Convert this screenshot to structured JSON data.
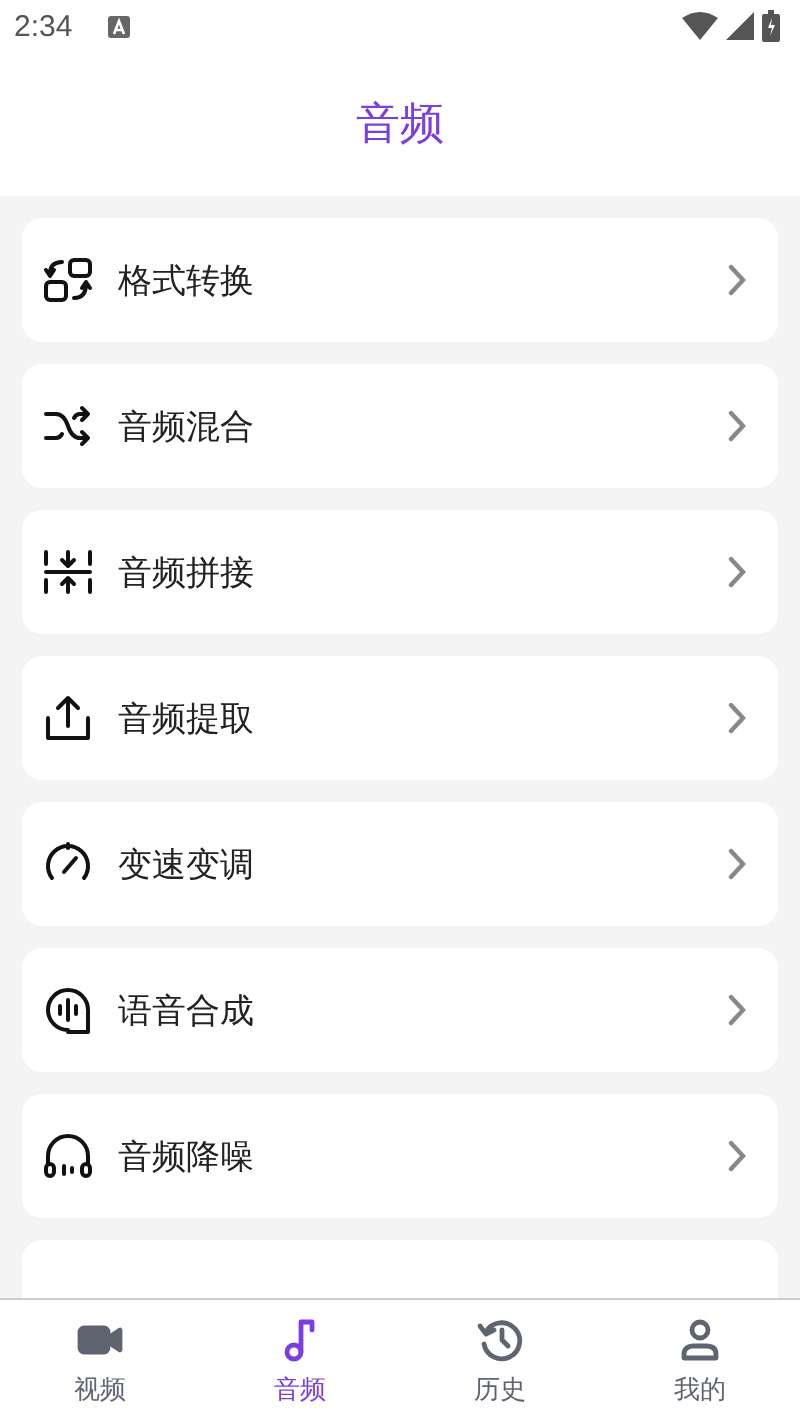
{
  "status_bar": {
    "time": "2:34"
  },
  "header": {
    "title": "音频"
  },
  "items": [
    {
      "label": "格式转换"
    },
    {
      "label": "音频混合"
    },
    {
      "label": "音频拼接"
    },
    {
      "label": "音频提取"
    },
    {
      "label": "变速变调"
    },
    {
      "label": "语音合成"
    },
    {
      "label": "音频降噪"
    }
  ],
  "bottom_nav": [
    {
      "label": "视频",
      "selected": false
    },
    {
      "label": "音频",
      "selected": true
    },
    {
      "label": "历史",
      "selected": false
    },
    {
      "label": "我的",
      "selected": false
    }
  ]
}
